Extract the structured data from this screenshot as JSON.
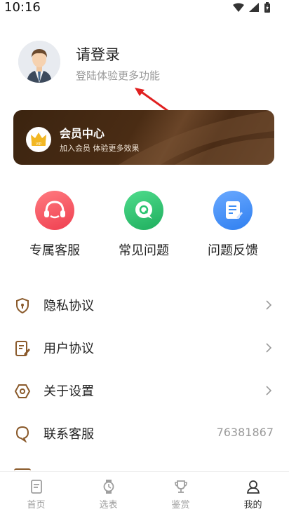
{
  "status_bar": {
    "time": "10:16"
  },
  "profile": {
    "title": "请登录",
    "subtitle": "登陆体验更多功能"
  },
  "vip": {
    "badge_text": "VIP",
    "title": "会员中心",
    "subtitle": "加入会员 体验更多效果"
  },
  "quick_actions": [
    {
      "label": "专属客服",
      "icon": "headset-icon",
      "color": "#f2505c"
    },
    {
      "label": "常见问题",
      "icon": "question-q-icon",
      "color": "#28c46f"
    },
    {
      "label": "问题反馈",
      "icon": "feedback-doc-icon",
      "color": "#3f8ff5"
    }
  ],
  "menu": [
    {
      "label": "隐私协议",
      "icon": "shield-icon"
    },
    {
      "label": "用户协议",
      "icon": "document-pen-icon"
    },
    {
      "label": "关于设置",
      "icon": "hexagon-settings-icon"
    },
    {
      "label": "联系客服",
      "icon": "chat-bubble-icon",
      "value": "76381867"
    }
  ],
  "tabs": [
    {
      "label": "首页",
      "icon": "home-doc-icon",
      "active": false
    },
    {
      "label": "选表",
      "icon": "watch-icon",
      "active": false
    },
    {
      "label": "鉴赏",
      "icon": "trophy-icon",
      "active": false
    },
    {
      "label": "我的",
      "icon": "user-icon",
      "active": true
    }
  ],
  "colors": {
    "accent_brown": "#8a5a2b",
    "vip_card": "#4a2c14",
    "annotation_arrow": "#e02020"
  }
}
